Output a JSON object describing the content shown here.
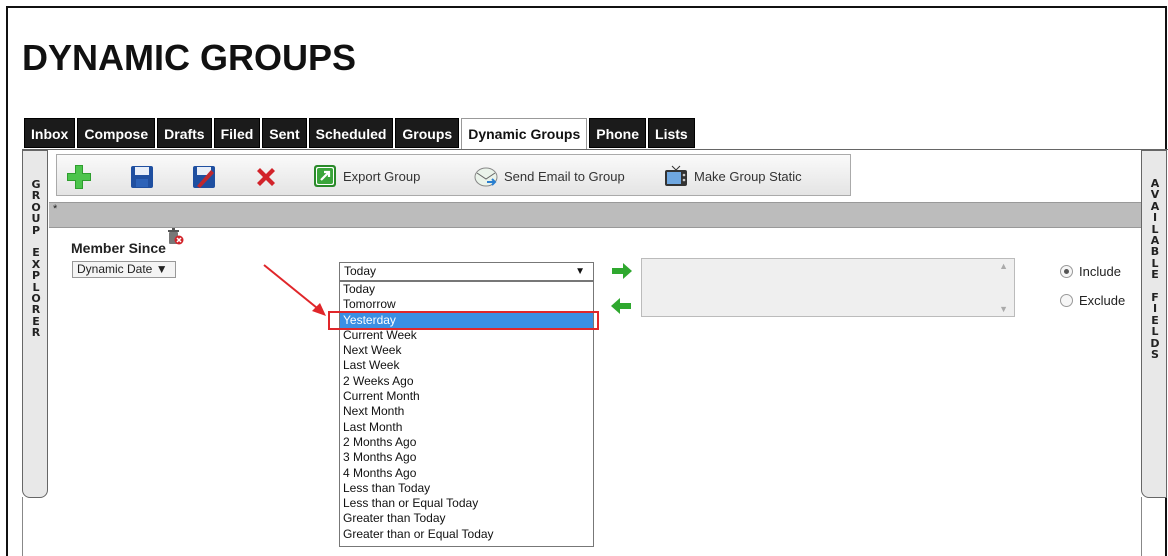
{
  "page_title": "DYNAMIC GROUPS",
  "tabs": [
    {
      "label": "Inbox",
      "active": false
    },
    {
      "label": "Compose",
      "active": false
    },
    {
      "label": "Drafts",
      "active": false
    },
    {
      "label": "Filed",
      "active": false
    },
    {
      "label": "Sent",
      "active": false
    },
    {
      "label": "Scheduled",
      "active": false
    },
    {
      "label": "Groups",
      "active": false
    },
    {
      "label": "Dynamic Groups",
      "active": true
    },
    {
      "label": "Phone",
      "active": false
    },
    {
      "label": "Lists",
      "active": false
    }
  ],
  "side_left_label": "GROUP EXPLORER",
  "side_right_label": "AVAILABLE FIELDS",
  "toolbar": {
    "add_icon": "plus-icon",
    "save_icon": "floppy-icon",
    "edit_icon": "edit-icon",
    "delete_icon": "delete-x-icon",
    "export_label": "Export Group",
    "send_label": "Send Email to Group",
    "static_label": "Make Group Static"
  },
  "gray_bar_marker": "*",
  "field": {
    "label": "Member Since",
    "type_select": "Dynamic Date ▼"
  },
  "date_select": {
    "value": "Today",
    "arrow": "▼",
    "options": [
      "Today",
      "Tomorrow",
      "Yesterday",
      "Current Week",
      "Next Week",
      "Last Week",
      "2 Weeks Ago",
      "Current Month",
      "Next Month",
      "Last Month",
      "2 Months Ago",
      "3 Months Ago",
      "4 Months Ago",
      "Less than Today",
      "Less than or Equal Today",
      "Greater than Today",
      "Greater than or Equal Today"
    ],
    "highlighted": "Yesterday"
  },
  "radios": {
    "include_label": "Include",
    "exclude_label": "Exclude",
    "selected": "include"
  },
  "colors": {
    "tab_bg": "#1b1b1b",
    "selection_blue": "#3b8fe3",
    "annotation_red": "#e0262a",
    "green_arrow": "#2fa82f"
  }
}
